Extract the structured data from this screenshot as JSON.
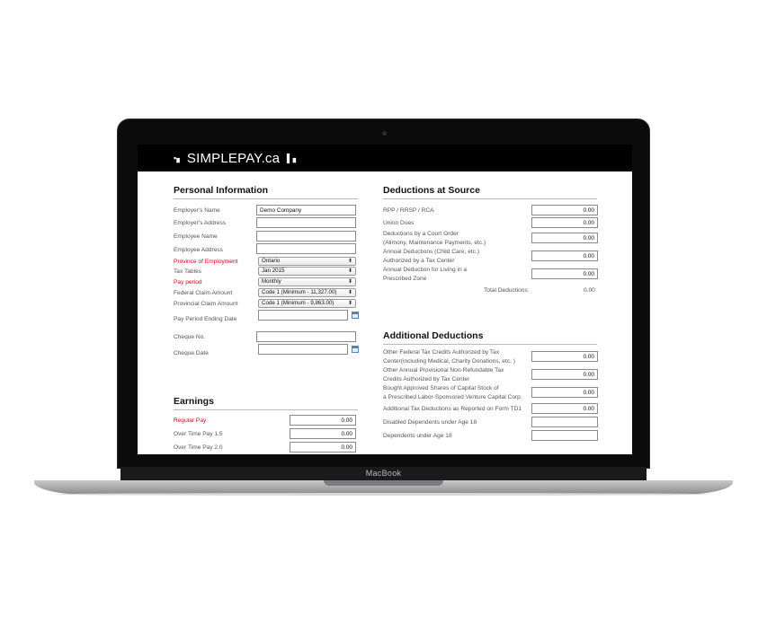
{
  "app": {
    "logo": "SIMPLEPAY.ca",
    "device_label": "MacBook"
  },
  "personal": {
    "title": "Personal Information",
    "employer_name_label": "Employer's Name",
    "employer_name_value": "Demo Company",
    "employer_address_label": "Employer's Address",
    "employee_name_label": "Employee Name",
    "employee_address_label": "Employee Address",
    "province_label": "Province of Employment",
    "province_value": "Ontario",
    "tax_tables_label": "Tax Tables",
    "tax_tables_value": "Jan 2015",
    "pay_period_label": "Pay period",
    "pay_period_value": "Monthly",
    "federal_claim_label": "Federal Claim Amount",
    "federal_claim_value": "Code 1 (Minimum - 11,327.00)",
    "provincial_claim_label": "Provincial Claim Amount",
    "provincial_claim_value": "Code 1 (Minimum - 9,863.00)",
    "pay_period_end_label": "Pay Period Ending Date",
    "cheque_no_label": "Cheque No.",
    "cheque_date_label": "Cheque Date"
  },
  "earnings": {
    "title": "Earnings",
    "regular_pay_label": "Regular Pay",
    "regular_pay_value": "0.00",
    "overtime_15_label": "Over Time Pay 1.5",
    "overtime_15_value": "0.00",
    "overtime_20_label": "Over Time Pay 2.0",
    "overtime_20_value": "0.00"
  },
  "deductions": {
    "title": "Deductions at Source",
    "rpp_label": "RPP / RRSP / RCA",
    "rpp_value": "0.00",
    "union_label": "Union Dues",
    "union_value": "0.00",
    "court_order_label_1": "Deductions by a Court Order",
    "court_order_label_2": "(Alimony, Maintenance Payments, etc.)",
    "court_order_value": "0.00",
    "annual_label_1": "Annual Deductions (Child Care, etc.)",
    "annual_label_2": "Authorized by a Tax Center",
    "annual_value": "0.00",
    "zone_label_1": "Annual Deduction for Living in a",
    "zone_label_2": "Prescribed Zone",
    "zone_value": "0.00",
    "total_label": "Total Deductions",
    "total_value": "0.00"
  },
  "additional": {
    "title": "Additional Deductions",
    "federal_credits_label_1": "Other Federal Tax Credits Authorized by Tax",
    "federal_credits_label_2": "Center(including Medical, Charity Donations, etc. )",
    "federal_credits_value": "0.00",
    "provincial_credits_label_1": "Other Annual Provisional Non-Refundable Tax",
    "provincial_credits_label_2": "Credits Authorized by Tax Center",
    "provincial_credits_value": "0.00",
    "shares_label_1": "Bought Approved Shares of Capital Stock of",
    "shares_label_2": "a Prescribed Labor-Sponsored Venture Capital Corp.",
    "shares_value": "0.00",
    "td1_label": "Additional Tax Deductions as Reported on Form TD1",
    "td1_value": "0.00",
    "disabled_dep_label": "Disabled Dependents under Age 18",
    "dependents_label": "Dependents under Age 18"
  }
}
